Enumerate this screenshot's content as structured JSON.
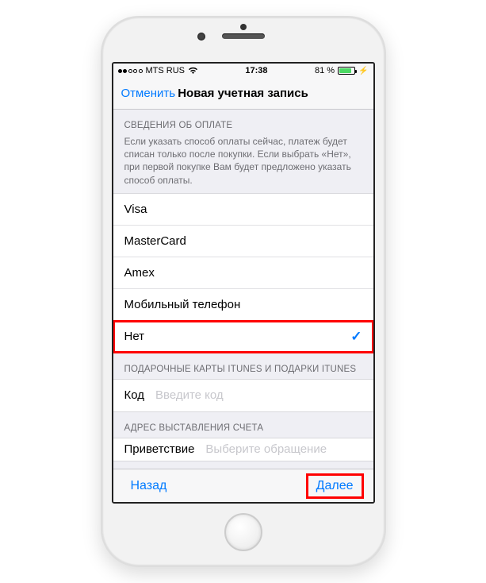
{
  "status": {
    "carrier": "MTS RUS",
    "time": "17:38",
    "battery_pct": "81 %",
    "battery_level": 81,
    "signal_filled": 2,
    "signal_total": 5,
    "wifi": true,
    "charging": true
  },
  "nav": {
    "cancel": "Отменить",
    "title": "Новая учетная запись"
  },
  "sections": {
    "payment": {
      "header": "СВЕДЕНИЯ ОБ ОПЛАТЕ",
      "desc": "Если указать способ оплаты сейчас, платеж будет списан только после покупки. Если выбрать «Нет», при первой покупке Вам будет предложено указать способ оплаты.",
      "options": [
        {
          "label": "Visa",
          "selected": false
        },
        {
          "label": "MasterCard",
          "selected": false
        },
        {
          "label": "Amex",
          "selected": false
        },
        {
          "label": "Мобильный телефон",
          "selected": false
        },
        {
          "label": "Нет",
          "selected": true
        }
      ]
    },
    "gift": {
      "header": "ПОДАРОЧНЫЕ КАРТЫ ITUNES И ПОДАРКИ ITUNES",
      "code_label": "Код",
      "code_placeholder": "Введите код"
    },
    "billing": {
      "header": "АДРЕС ВЫСТАВЛЕНИЯ СЧЕТА",
      "salutation_label": "Приветствие",
      "salutation_placeholder": "Выберите обращение"
    }
  },
  "toolbar": {
    "back": "Назад",
    "next": "Далее"
  }
}
